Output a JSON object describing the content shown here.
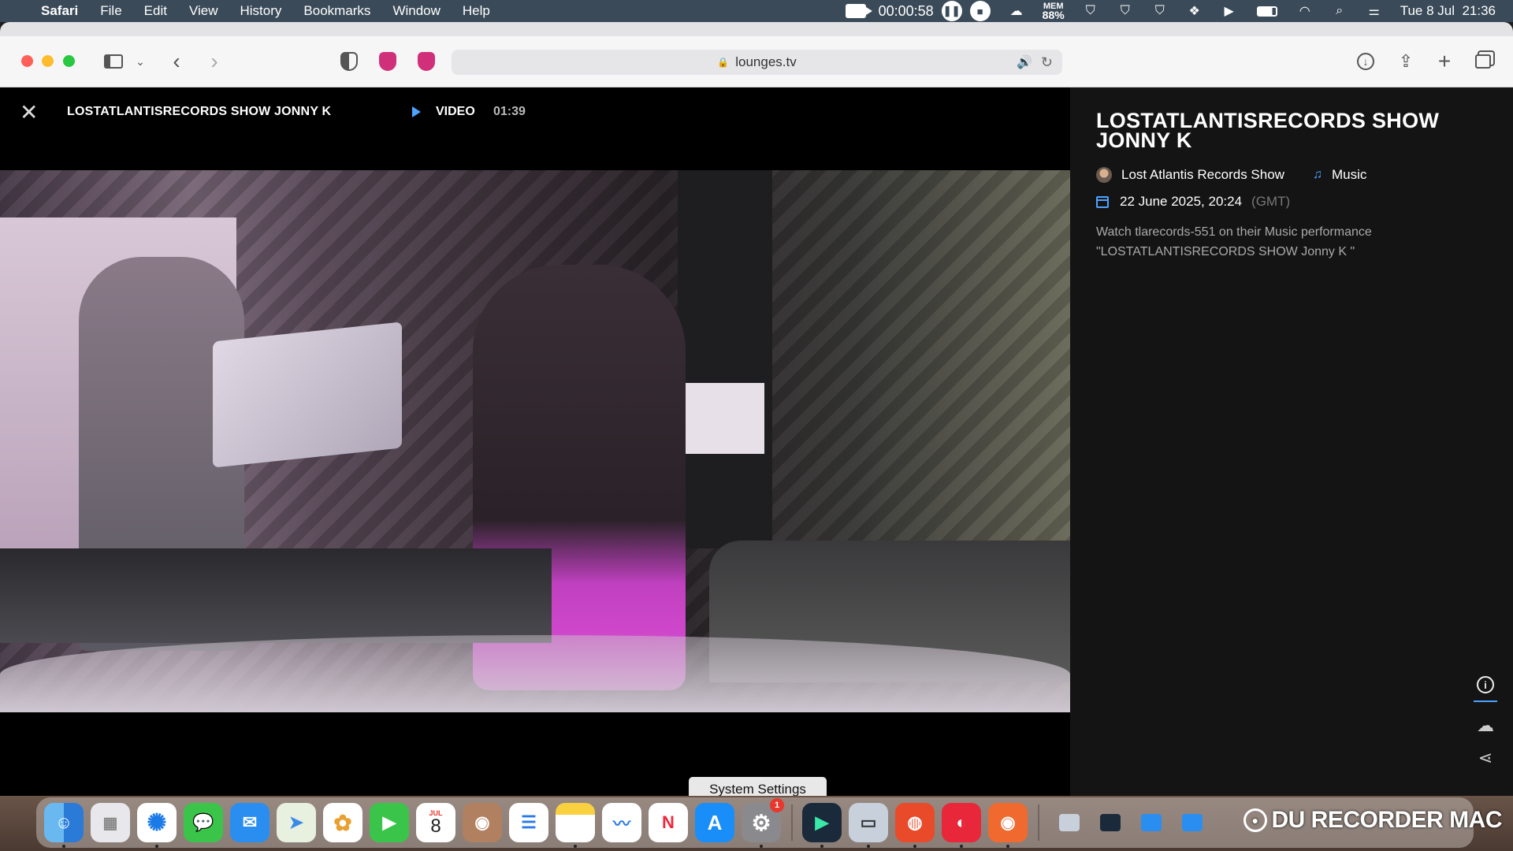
{
  "menubar": {
    "app_name": "Safari",
    "menus": [
      "File",
      "Edit",
      "View",
      "History",
      "Bookmarks",
      "Window",
      "Help"
    ],
    "recording_time": "00:00:58",
    "mem_label": "MEM",
    "mem_value": "88%",
    "datetime": "Tue 8 Jul  21:36"
  },
  "browser": {
    "url": "lounges.tv"
  },
  "video": {
    "title": "LOSTATLANTISRECORDS SHOW JONNY K",
    "type_label": "VIDEO",
    "duration": "01:39"
  },
  "details": {
    "title": "LOSTATLANTISRECORDS SHOW JONNY K",
    "channel": "Lost Atlantis Records Show",
    "category": "Music",
    "date": "22 June 2025, 20:24",
    "timezone": "(GMT)",
    "description": "Watch tlarecords-551 on their Music performance \"LOSTATLANTISRECORDS SHOW Jonny K \""
  },
  "tooltip": "System Settings",
  "dock": {
    "calendar_month": "JUL",
    "calendar_day": "8",
    "settings_badge": "1",
    "watermark": "DU RECORDER MAC"
  },
  "colors": {
    "accent_blue": "#4da3ff",
    "menubar_bg": "#3a4a58",
    "panel_bg": "#141414"
  }
}
